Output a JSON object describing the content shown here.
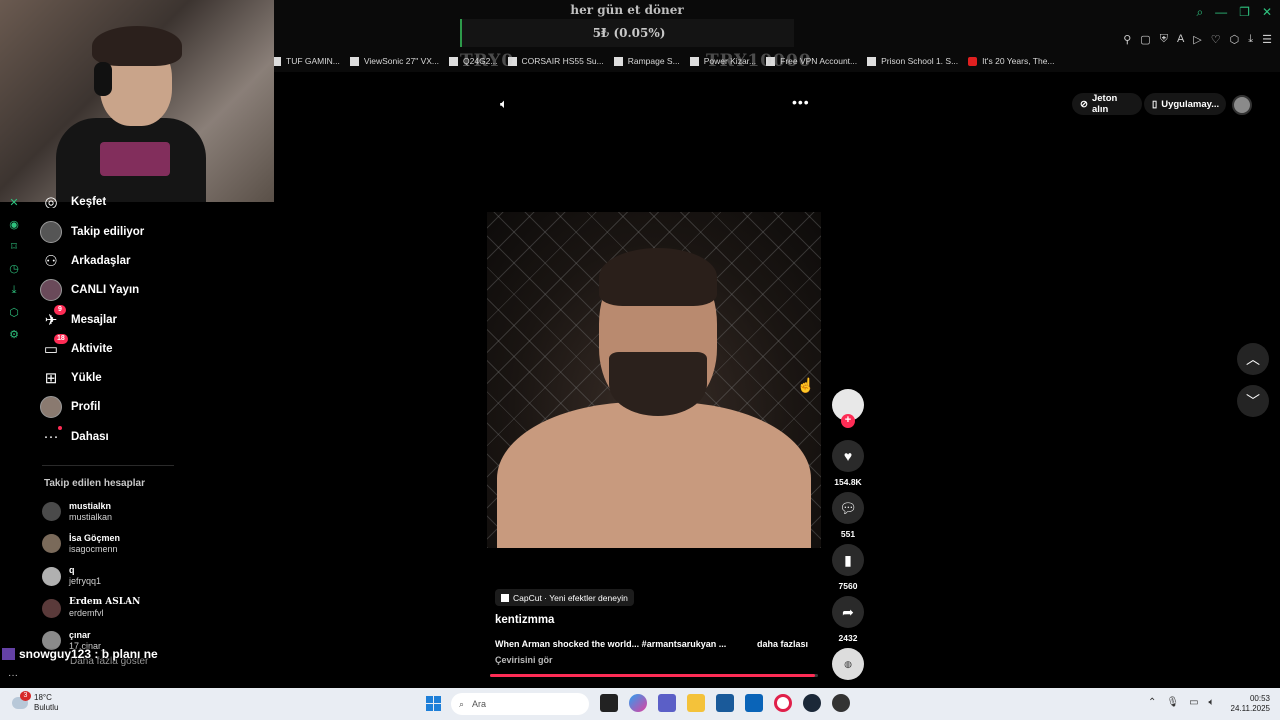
{
  "donation": {
    "title": "her gün et döner",
    "value": "5₺ (0.05%)",
    "goal_min": "TRY0",
    "goal_max": "TRY10000",
    "progress_fraction": 0.0005
  },
  "bookmarks": [
    "TUF GAMIN...",
    "ViewSonic 27\" VX...",
    "Q24G2...",
    "CORSAIR HS55 Su...",
    "Rampage S...",
    "Power Kizar...",
    "Free VPN Account...",
    "Prison School 1. S...",
    "It's 20 Years, The..."
  ],
  "sidebar": {
    "items": [
      {
        "label": "Keşfet",
        "icon": "compass-icon"
      },
      {
        "label": "Takip ediliyor",
        "icon": "following-avatar-icon"
      },
      {
        "label": "Arkadaşlar",
        "icon": "friends-icon"
      },
      {
        "label": "CANLI Yayın",
        "icon": "live-avatar-icon"
      },
      {
        "label": "Mesajlar",
        "icon": "messages-icon",
        "badge": "9"
      },
      {
        "label": "Aktivite",
        "icon": "activity-icon",
        "badge": "18"
      },
      {
        "label": "Yükle",
        "icon": "upload-icon"
      },
      {
        "label": "Profil",
        "icon": "profile-avatar-icon"
      },
      {
        "label": "Dahası",
        "icon": "more-dots-icon"
      }
    ],
    "following_title": "Takip edilen hesaplar",
    "following": [
      {
        "name": "mustialkn",
        "username": "mustialkan"
      },
      {
        "name": "İsa Göçmen",
        "username": "isagocmenn"
      },
      {
        "name": "q",
        "username": "jefryqq1"
      },
      {
        "name": "Erdem ASLAN",
        "username": "erdemfvl"
      },
      {
        "name": "çınar",
        "username": "17.cinar_"
      }
    ],
    "show_more": "Daha fazla göster"
  },
  "chat_overlay": "snowguy123 : b planı ne",
  "header": {
    "coins_label": "Jeton alın",
    "app_label": "Uygulamay..."
  },
  "video": {
    "likes": "154.8K",
    "comments": "551",
    "saves": "7560",
    "shares": "2432",
    "capcut": "CapCut · Yeni efektler deneyin",
    "author": "kentizmma",
    "description": "When Arman shocked the world... #armantsarukyan ...",
    "more": "daha fazlası",
    "translate": "Çevirisini gör",
    "progress_fraction": 0.99
  },
  "taskbar": {
    "temp": "18°C",
    "weather": "Bulutlu",
    "weather_badge": "3",
    "search_placeholder": "Ara",
    "time": "00:53",
    "date": "24.11.2025"
  }
}
